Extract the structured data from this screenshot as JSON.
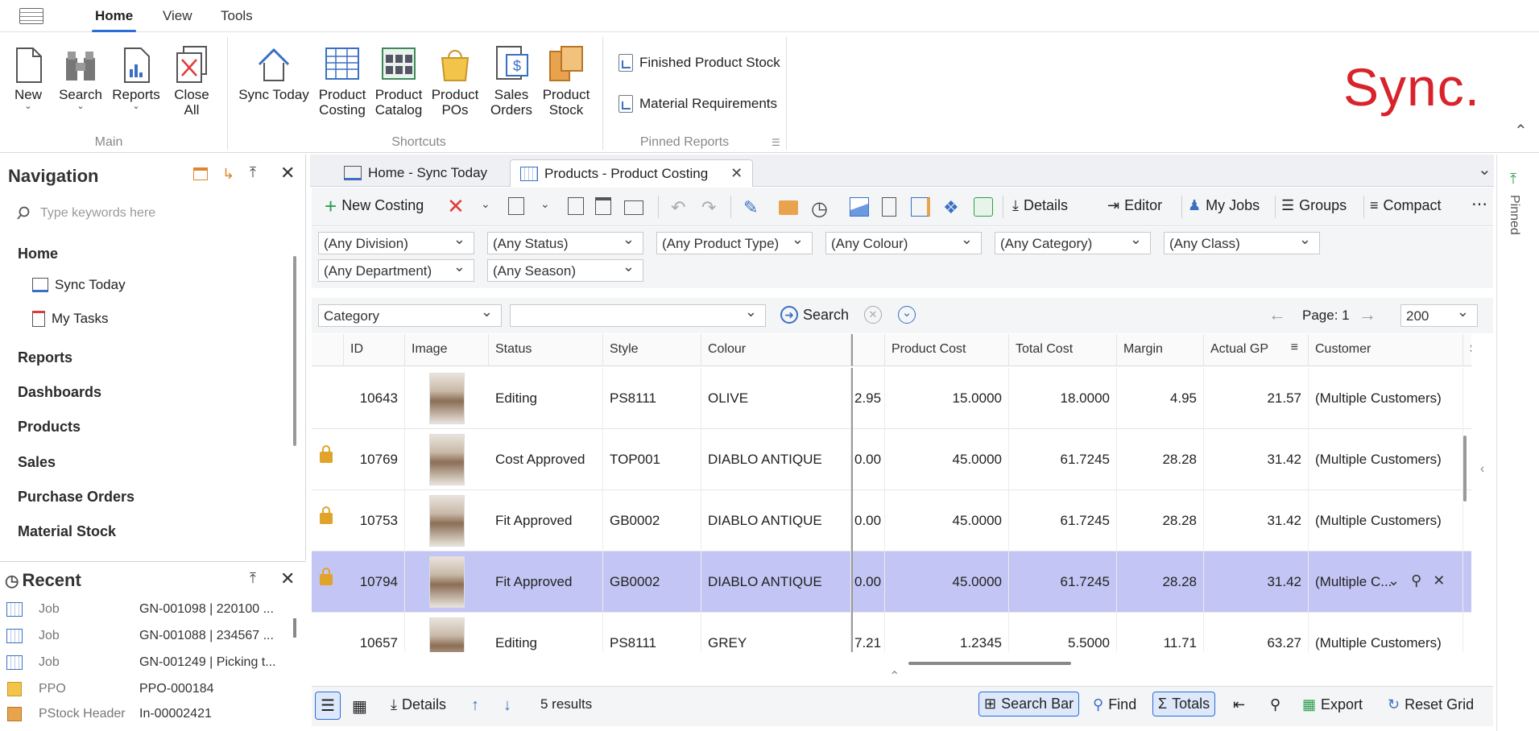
{
  "menu": {
    "app_icon": "app-menu-icon",
    "tabs": [
      "Home",
      "View",
      "Tools"
    ]
  },
  "ribbon": {
    "main": [
      {
        "label": "New",
        "icon": "new-document-icon"
      },
      {
        "label": "Search",
        "icon": "search-binoculars-icon"
      },
      {
        "label": "Reports",
        "icon": "reports-icon"
      },
      {
        "label": "Close All",
        "icon": "close-all-icon"
      }
    ],
    "main_group": "Main",
    "shortcuts": [
      {
        "label": "Sync Today",
        "icon": "home-icon"
      },
      {
        "label": "Product Costing",
        "icon": "grid-icon"
      },
      {
        "label": "Product Catalog",
        "icon": "catalog-icon"
      },
      {
        "label": "Product POs",
        "icon": "bag-icon"
      },
      {
        "label": "Sales Orders",
        "icon": "sales-orders-icon"
      },
      {
        "label": "Product Stock",
        "icon": "stock-icon"
      }
    ],
    "shortcuts_group": "Shortcuts",
    "pinned": [
      "Finished Product Stock",
      "Material Requirements"
    ],
    "pinned_group": "Pinned Reports",
    "logo": "Sync."
  },
  "nav": {
    "title": "Navigation",
    "search_placeholder": "Type keywords here",
    "items": [
      "Home",
      "Reports",
      "Dashboards",
      "Products",
      "Sales",
      "Purchase Orders",
      "Material Stock"
    ],
    "sub": [
      "Sync Today",
      "My Tasks"
    ]
  },
  "recent": {
    "title": "Recent",
    "rows": [
      {
        "type": "Job",
        "value": "GN-001098 | 220100 ..."
      },
      {
        "type": "Job",
        "value": "GN-001088 | 234567 ..."
      },
      {
        "type": "Job",
        "value": "GN-001249 | Picking t..."
      },
      {
        "type": "PPO",
        "value": "PPO-000184"
      },
      {
        "type": "PStock Header",
        "value": "In-00002421"
      }
    ]
  },
  "doctabs": [
    "Home - Sync Today",
    "Products - Product Costing"
  ],
  "toolbar": {
    "new": "New Costing",
    "details": "Details",
    "editor": "Editor",
    "myjobs": "My Jobs",
    "groups": "Groups",
    "compact": "Compact"
  },
  "filters": [
    "(Any Division)",
    "(Any Status)",
    "(Any Product Type)",
    "(Any Colour)",
    "(Any Category)",
    "(Any Class)",
    "(Any Department)",
    "(Any Season)"
  ],
  "search": {
    "field": "Category",
    "value": "",
    "button": "Search",
    "page": "Page: 1",
    "page_size": "200"
  },
  "grid": {
    "columns": [
      "ID",
      "Image",
      "Status",
      "Style",
      "Colour",
      "Product Cost",
      "Total Cost",
      "Margin",
      "Actual GP",
      "Customer",
      "Siz"
    ],
    "rows": [
      {
        "lock": false,
        "id": "10643",
        "status": "Editing",
        "style": "PS8111",
        "colour": "OLIVE",
        "hidden": "2.95",
        "pcost": "15.0000",
        "tcost": "18.0000",
        "margin": "4.95",
        "gp": "21.57",
        "customer": "(Multiple Customers)"
      },
      {
        "lock": true,
        "id": "10769",
        "status": "Cost Approved",
        "style": "TOP001",
        "colour": "DIABLO ANTIQUE",
        "hidden": "0.00",
        "pcost": "45.0000",
        "tcost": "61.7245",
        "margin": "28.28",
        "gp": "31.42",
        "customer": "(Multiple Customers)"
      },
      {
        "lock": true,
        "id": "10753",
        "status": "Fit Approved",
        "style": "GB0002",
        "colour": "DIABLO ANTIQUE",
        "hidden": "0.00",
        "pcost": "45.0000",
        "tcost": "61.7245",
        "margin": "28.28",
        "gp": "31.42",
        "customer": "(Multiple Customers)"
      },
      {
        "lock": true,
        "id": "10794",
        "status": "Fit Approved",
        "style": "GB0002",
        "colour": "DIABLO ANTIQUE",
        "hidden": "0.00",
        "pcost": "45.0000",
        "tcost": "61.7245",
        "margin": "28.28",
        "gp": "31.42",
        "customer": "(Multiple C..."
      },
      {
        "lock": false,
        "id": "10657",
        "status": "Editing",
        "style": "PS8111",
        "colour": "GREY",
        "hidden": "7.21",
        "pcost": "1.2345",
        "tcost": "5.5000",
        "margin": "11.71",
        "gp": "63.27",
        "customer": "(Multiple Customers)"
      }
    ]
  },
  "bottom": {
    "details": "Details",
    "results": "5 results",
    "searchbar": "Search Bar",
    "find": "Find",
    "totals": "Totals",
    "export": "Export",
    "reset": "Reset Grid"
  },
  "pinned_side": "Pinned"
}
